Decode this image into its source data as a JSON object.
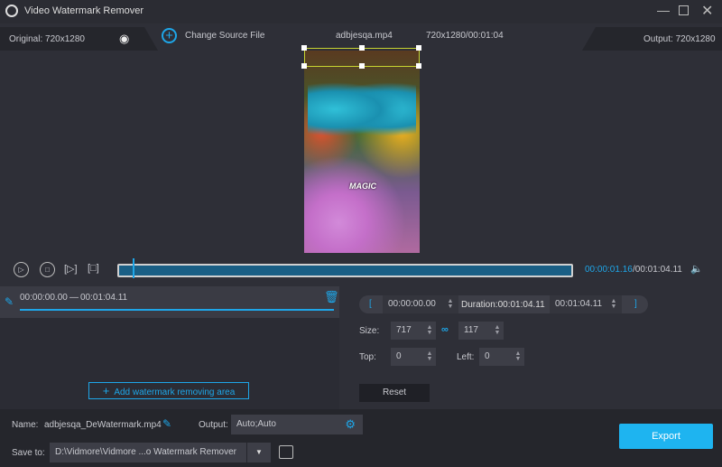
{
  "app": {
    "title": "Video Watermark Remover",
    "accent": "#1ea6e8"
  },
  "infobar": {
    "original": "Original: 720x1280",
    "change_source": "Change Source File",
    "filename": "adbjesqa.mp4",
    "meta": "720x1280/00:01:04",
    "output": "Output: 720x1280"
  },
  "preview": {
    "overlay_text": "MAGIC"
  },
  "playback": {
    "current": "00:00:01.16",
    "total": "/00:01:04.11",
    "progress": 0.03
  },
  "segments": [
    {
      "range_start": "00:00:00.00",
      "sep": "—",
      "range_end": "00:01:04.11"
    }
  ],
  "add_area_label": "Add watermark removing area",
  "timing": {
    "start": "00:00:00.00",
    "duration": "Duration:00:01:04.11",
    "end": "00:01:04.11",
    "open_bracket": "[",
    "close_bracket": "]"
  },
  "size": {
    "label": "Size:",
    "width": "717",
    "height": "117"
  },
  "position": {
    "top_label": "Top:",
    "top": "0",
    "left_label": "Left:",
    "left": "0"
  },
  "reset_label": "Reset",
  "bottom": {
    "name_label": "Name:",
    "name": "adbjesqa_DeWatermark.mp4",
    "output_label": "Output:",
    "output": "Auto;Auto",
    "save_label": "Save to:",
    "save_path": "D:\\Vidmore\\Vidmore ...o Watermark Remover",
    "export": "Export"
  }
}
